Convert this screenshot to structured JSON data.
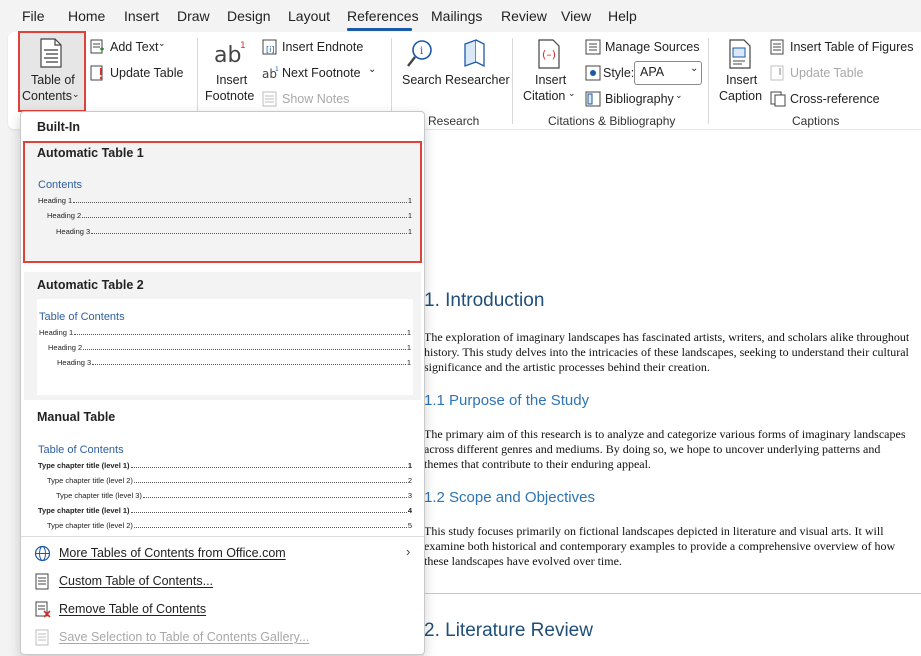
{
  "menubar": {
    "items": [
      "File",
      "Home",
      "Insert",
      "Draw",
      "Design",
      "Layout",
      "References",
      "Mailings",
      "Review",
      "View",
      "Help"
    ],
    "active": "References"
  },
  "ribbon": {
    "toc": {
      "line1": "Table of",
      "line2": "Contents"
    },
    "add_text": "Add Text",
    "update_table": "Update Table",
    "insert_footnote": {
      "line1": "Insert",
      "line2": "Footnote"
    },
    "insert_endnote": "Insert Endnote",
    "next_footnote": "Next Footnote",
    "show_notes": "Show Notes",
    "search": "Search",
    "researcher": "Researcher",
    "research_group": "Research",
    "insert_citation": {
      "line1": "Insert",
      "line2": "Citation"
    },
    "manage_sources": "Manage Sources",
    "style_label": "Style:",
    "style_value": "APA",
    "bibliography": "Bibliography",
    "citations_group": "Citations & Bibliography",
    "insert_caption": {
      "line1": "Insert",
      "line2": "Caption"
    },
    "insert_table_of_figures": "Insert Table of Figures",
    "update_table_disabled": "Update Table",
    "cross_reference": "Cross-reference",
    "captions_group": "Captions"
  },
  "dropdown": {
    "built_in": "Built-In",
    "auto1": {
      "title": "Automatic Table 1",
      "heading": "Contents",
      "lines": [
        {
          "label": "Heading 1",
          "page": "1",
          "indent": 0
        },
        {
          "label": "Heading 2",
          "page": "1",
          "indent": 1
        },
        {
          "label": "Heading 3",
          "page": "1",
          "indent": 2
        }
      ]
    },
    "auto2": {
      "title": "Automatic Table 2",
      "heading": "Table of Contents",
      "lines": [
        {
          "label": "Heading 1",
          "page": "1",
          "indent": 0
        },
        {
          "label": "Heading 2",
          "page": "1",
          "indent": 1
        },
        {
          "label": "Heading 3",
          "page": "1",
          "indent": 2
        }
      ]
    },
    "manual": {
      "title": "Manual Table",
      "heading": "Table of Contents",
      "lines": [
        {
          "label": "Type chapter title (level 1)",
          "page": "1",
          "indent": 0,
          "bold": true
        },
        {
          "label": "Type chapter title (level 2)",
          "page": "2",
          "indent": 1,
          "bold": false
        },
        {
          "label": "Type chapter title (level 3)",
          "page": "3",
          "indent": 2,
          "bold": false
        },
        {
          "label": "Type chapter title (level 1)",
          "page": "4",
          "indent": 0,
          "bold": true
        },
        {
          "label": "Type chapter title (level 2)",
          "page": "5",
          "indent": 1,
          "bold": false
        }
      ]
    },
    "bottom_items": [
      {
        "label": "More Tables of Contents from Office.com",
        "icon": "globe-icon",
        "disabled": false,
        "submenu": true
      },
      {
        "label": "Custom Table of Contents...",
        "icon": "document-icon",
        "disabled": false,
        "submenu": false
      },
      {
        "label": "Remove Table of Contents",
        "icon": "remove-document-icon",
        "disabled": false,
        "submenu": false
      },
      {
        "label": "Save Selection to Table of Contents Gallery...",
        "icon": "save-gallery-icon",
        "disabled": true,
        "submenu": false
      }
    ]
  },
  "document": {
    "h1_intro": "1. Introduction",
    "p_intro": "The exploration of imaginary landscapes has fascinated artists, writers, and scholars alike throughout history. This study delves into the intricacies of these landscapes, seeking to understand their cultural significance and the artistic processes behind their creation.",
    "h2_purpose": "1.1 Purpose of the Study",
    "p_purpose": "The primary aim of this research is to analyze and categorize various forms of imaginary landscapes across different genres and mediums. By doing so, we hope to uncover underlying patterns and themes that contribute to their enduring appeal.",
    "h2_scope": "1.2 Scope and Objectives",
    "p_scope": "This study focuses primarily on fictional landscapes depicted in literature and visual arts. It will examine both historical and contemporary examples to provide a comprehensive overview of how these landscapes have evolved over time.",
    "h1_lit": "2. Literature Review"
  },
  "colors": {
    "highlight": "#e0413a",
    "accent": "#1b5aab",
    "heading": "#1f4e79"
  }
}
